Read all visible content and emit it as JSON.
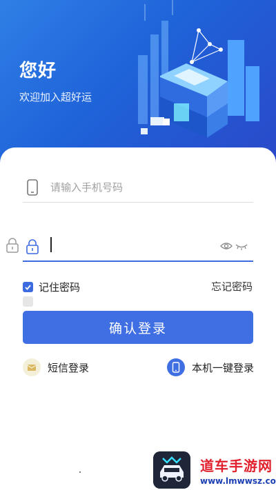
{
  "header": {
    "greeting": "您好",
    "welcome": "欢迎加入超好运",
    "background_colors": [
      "#2f7fe6",
      "#2a49c9"
    ]
  },
  "form": {
    "phone": {
      "placeholder": "请输入手机号码",
      "value": "",
      "icon": "phone-icon"
    },
    "password": {
      "placeholder": "",
      "value": "",
      "icon": "lock-icon",
      "visibility_icons": [
        "eye-icon",
        "eye-closed-icon"
      ]
    },
    "remember_label": "记住密码",
    "remember_checked": true,
    "forgot_label": "忘记密码",
    "submit_label": "确认登录"
  },
  "alt_logins": {
    "sms_label": "短信登录",
    "onekey_label": "本机一键登录"
  },
  "watermark": {
    "name": "道车手游网",
    "url": "www.lmwwsz.com"
  },
  "colors": {
    "accent": "#3f6fe3",
    "text": "#222222",
    "placeholder": "#a0a0a0"
  }
}
